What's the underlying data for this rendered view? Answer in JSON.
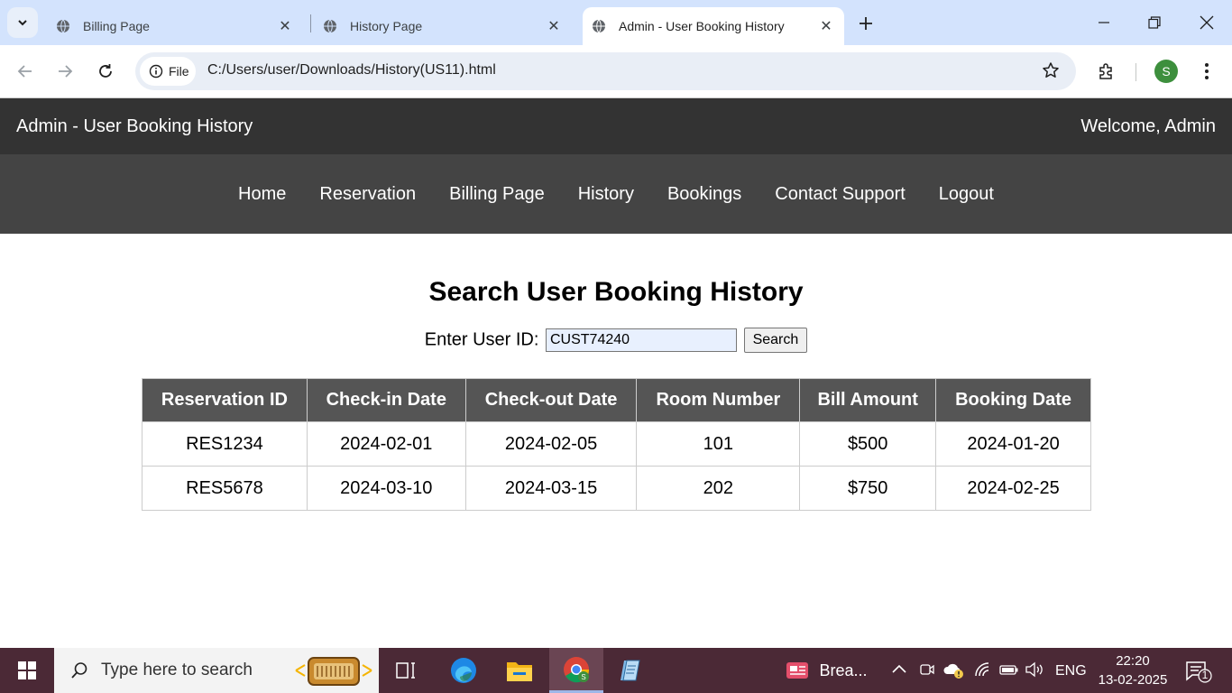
{
  "browser": {
    "tabs": [
      {
        "title": "Billing Page",
        "active": false
      },
      {
        "title": "History Page",
        "active": false
      },
      {
        "title": "Admin - User Booking History",
        "active": true
      }
    ],
    "address_chip": "File",
    "url": "C:/Users/user/Downloads/History(US11).html",
    "profile_initial": "S"
  },
  "header": {
    "title": "Admin - User Booking History",
    "welcome": "Welcome, Admin"
  },
  "nav": {
    "items": [
      "Home",
      "Reservation",
      "Billing Page",
      "History",
      "Bookings",
      "Contact Support",
      "Logout"
    ]
  },
  "main": {
    "heading": "Search User Booking History",
    "user_id_label": "Enter User ID:",
    "user_id_value": "CUST74240",
    "search_button": "Search",
    "table": {
      "columns": [
        "Reservation ID",
        "Check-in Date",
        "Check-out Date",
        "Room Number",
        "Bill Amount",
        "Booking Date"
      ],
      "rows": [
        [
          "RES1234",
          "2024-02-01",
          "2024-02-05",
          "101",
          "$500",
          "2024-01-20"
        ],
        [
          "RES5678",
          "2024-03-10",
          "2024-03-15",
          "202",
          "$750",
          "2024-02-25"
        ]
      ]
    }
  },
  "taskbar": {
    "search_placeholder": "Type here to search",
    "pinned_app_label": "Brea...",
    "language": "ENG",
    "time": "22:20",
    "date": "13-02-2025",
    "notification_count": "1"
  }
}
